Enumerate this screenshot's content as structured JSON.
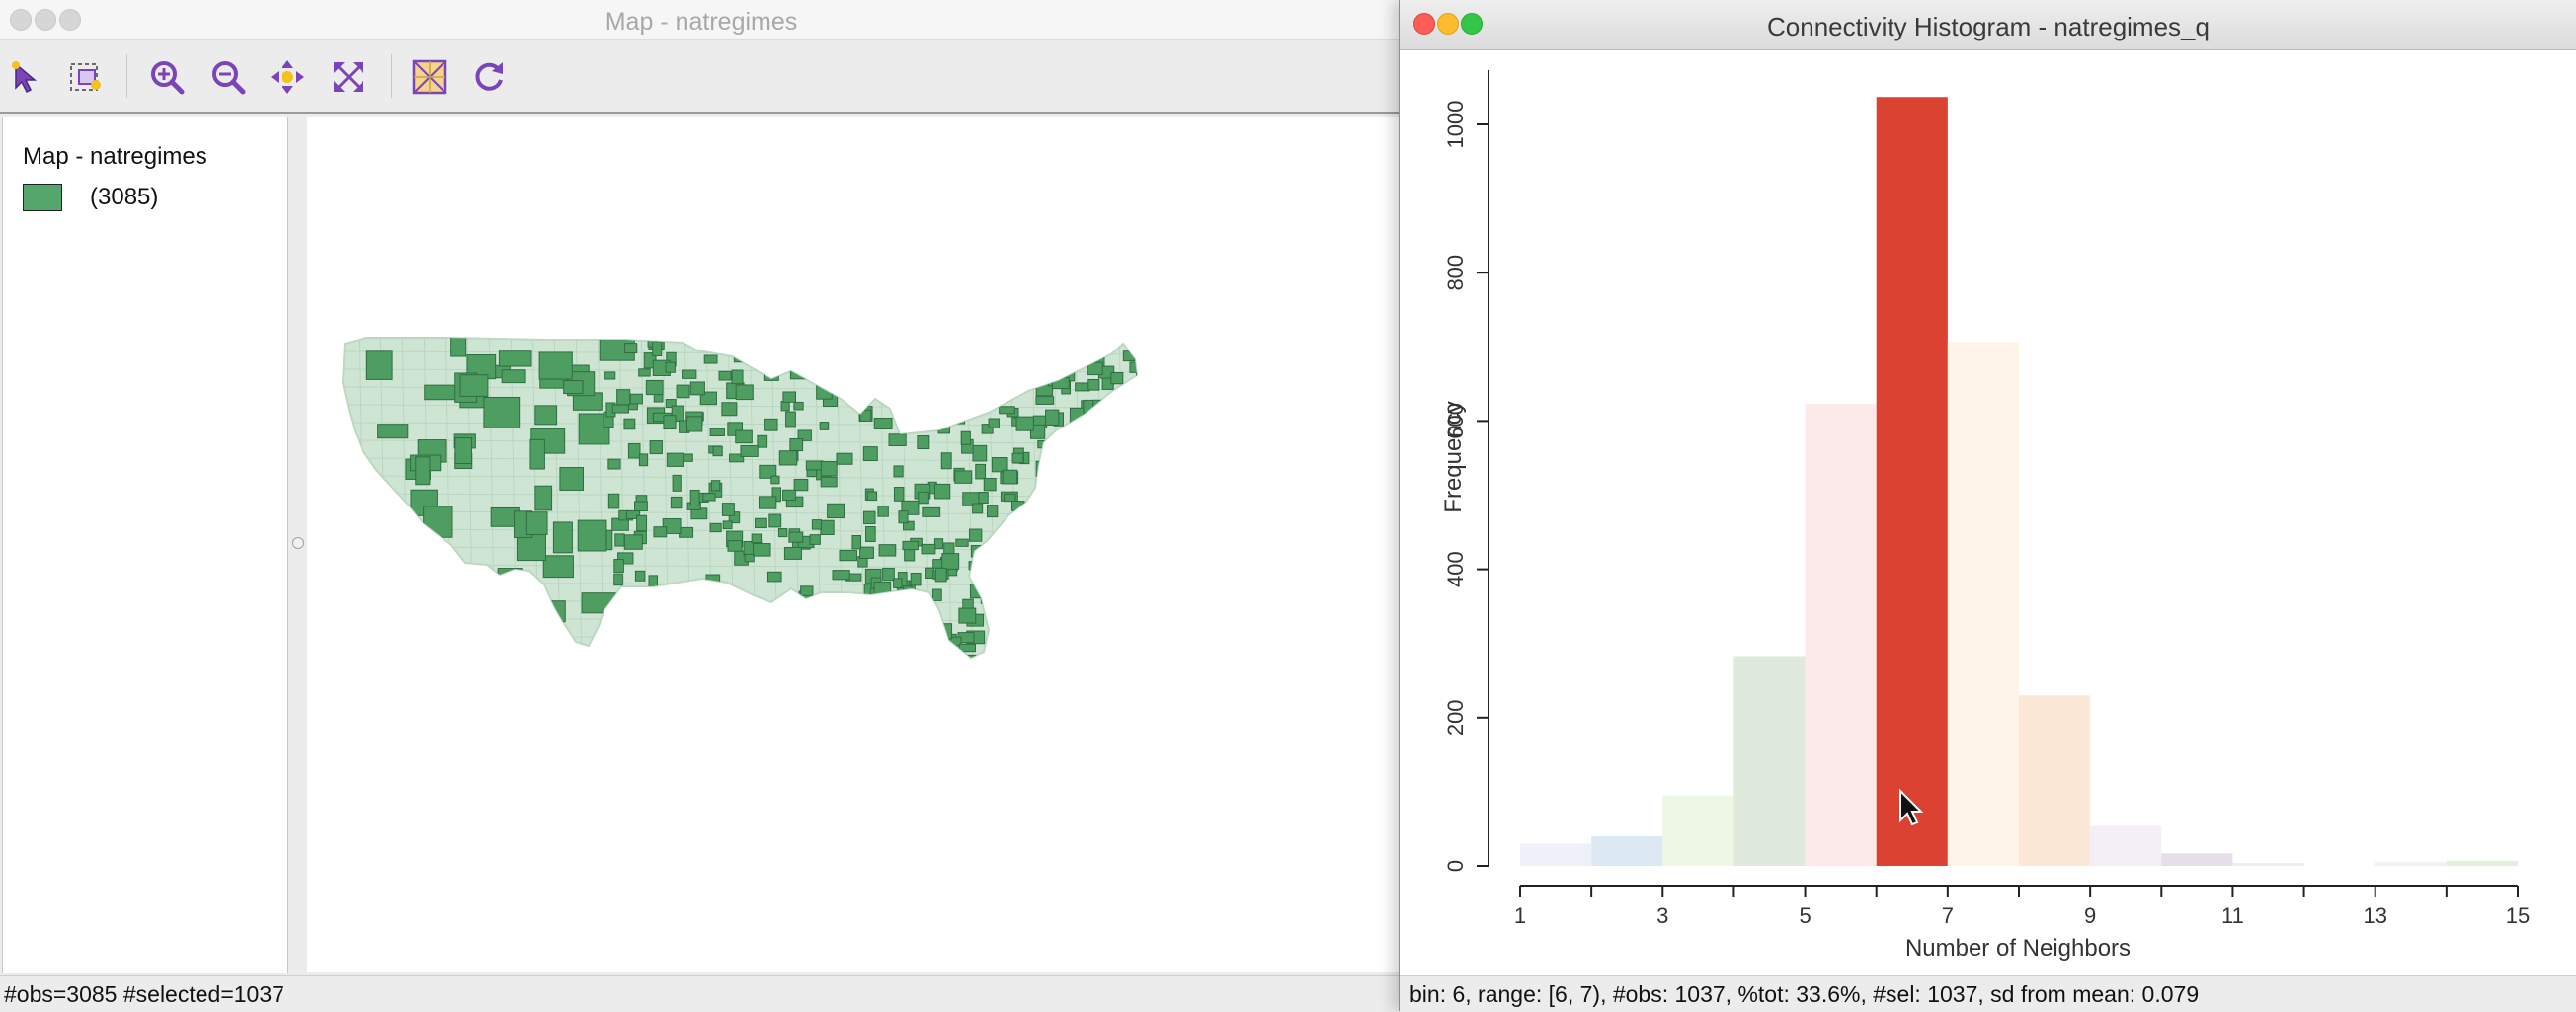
{
  "map_window": {
    "title": "Map - natregimes",
    "toolbar": [
      {
        "name": "select-tool-icon"
      },
      {
        "name": "selection-shape-icon"
      },
      {
        "name": "zoom-in-icon"
      },
      {
        "name": "zoom-out-icon"
      },
      {
        "name": "pan-icon"
      },
      {
        "name": "full-extent-icon"
      },
      {
        "name": "base-map-icon"
      },
      {
        "name": "refresh-icon"
      }
    ],
    "legend": {
      "title": "Map - natregimes",
      "category_label": "(3085)",
      "swatch_color": "#54a66c"
    },
    "map_colors": {
      "selected": "#4e9e61",
      "unselected": "#cfe5d3"
    },
    "status": "#obs=3085 #selected=1037"
  },
  "hist_window": {
    "title": "Connectivity Histogram - natregimes_q",
    "status": "bin: 6, range: [6, 7), #obs: 1037, %tot: 33.6%, #sel: 1037, sd from mean: 0.079"
  },
  "chart_data": {
    "type": "bar",
    "xlabel": "Number of Neighbors",
    "ylabel": "Frequency",
    "xlim": [
      1,
      15
    ],
    "ylim": [
      0,
      1000
    ],
    "x_ticks": [
      1,
      3,
      5,
      7,
      9,
      11,
      13,
      15
    ],
    "y_ticks": [
      0,
      200,
      400,
      600,
      800,
      1000
    ],
    "bins": [
      {
        "range": [
          1,
          2
        ],
        "value": 30,
        "color": "#eef2f8"
      },
      {
        "range": [
          2,
          3
        ],
        "value": 40,
        "color": "#dde9f2"
      },
      {
        "range": [
          3,
          4
        ],
        "value": 95,
        "color": "#eef6e6"
      },
      {
        "range": [
          4,
          5
        ],
        "value": 283,
        "color": "#dfeadd"
      },
      {
        "range": [
          5,
          6
        ],
        "value": 623,
        "color": "#fce9e9"
      },
      {
        "range": [
          6,
          7
        ],
        "value": 1037,
        "color": "#db4232",
        "selected": true
      },
      {
        "range": [
          7,
          8
        ],
        "value": 707,
        "color": "#fef4e7"
      },
      {
        "range": [
          8,
          9
        ],
        "value": 230,
        "color": "#fbe8d7"
      },
      {
        "range": [
          9,
          10
        ],
        "value": 54,
        "color": "#f4eef6"
      },
      {
        "range": [
          10,
          11
        ],
        "value": 17,
        "color": "#e6dfea"
      },
      {
        "range": [
          11,
          12
        ],
        "value": 4,
        "color": "#e9eef4"
      },
      {
        "range": [
          12,
          13
        ],
        "value": 0,
        "color": "#ffffff"
      },
      {
        "range": [
          13,
          14
        ],
        "value": 5,
        "color": "#eef4ea"
      },
      {
        "range": [
          14,
          15
        ],
        "value": 7,
        "color": "#e3efdf"
      }
    ],
    "grid": false,
    "legend": "none"
  }
}
